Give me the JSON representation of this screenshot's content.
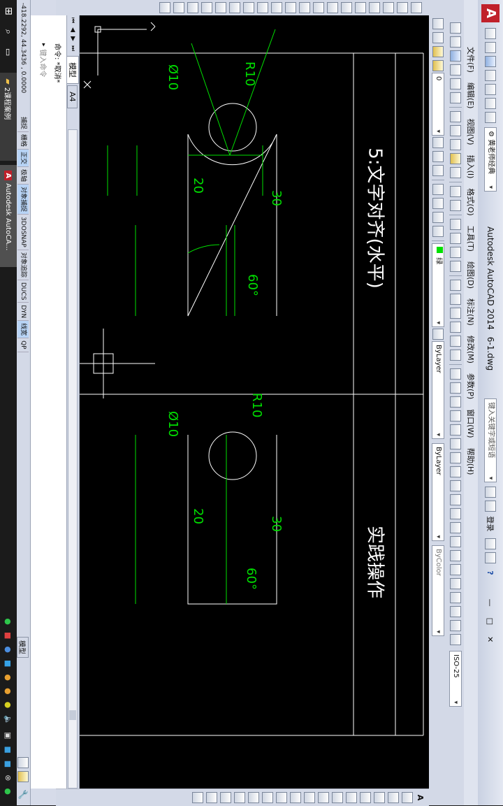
{
  "title_bar": {
    "app_title": "Autodesk AutoCAD 2014",
    "file_name": "6-1.dwg",
    "workspace": "黄老师经典",
    "search_placeholder": "键入关键字或短语",
    "login_label": "登录"
  },
  "menu": [
    "文件(F)",
    "编辑(E)",
    "视图(V)",
    "插入(I)",
    "格式(O)",
    "工具(T)",
    "绘图(D)",
    "标注(N)",
    "修改(M)",
    "参数(P)",
    "窗口(W)",
    "帮助(H)"
  ],
  "properties": {
    "layer": "0",
    "color_label": "绿",
    "linetype": "ByLayer",
    "lineweight": "ByLayer",
    "plotstyle": "ByColor",
    "dimstyle": "ISO-25"
  },
  "tabs": {
    "model": "模型",
    "layout": "A4"
  },
  "drawing": {
    "heading_left": "5:文字对齐(水平)",
    "heading_right": "实践操作",
    "left_part": {
      "r": "R10",
      "d": "Ø10",
      "width": "20",
      "height": "30",
      "angle": "60°"
    },
    "right_part": {
      "r": "R10",
      "d": "Ø10",
      "width": "20",
      "height": "30",
      "angle": "60°"
    }
  },
  "command_area": {
    "line1": "命令: *取消*",
    "placeholder": "键入命令"
  },
  "status_bar": {
    "coords": "-418.2292, 44.3436 , 0.0000",
    "toggles": [
      {
        "label": "捕捉",
        "on": false
      },
      {
        "label": "栅格",
        "on": false
      },
      {
        "label": "正交",
        "on": true
      },
      {
        "label": "极轴",
        "on": false
      },
      {
        "label": "对象捕捉",
        "on": true
      },
      {
        "label": "3DOSNAP",
        "on": false
      },
      {
        "label": "对象追踪",
        "on": false
      },
      {
        "label": "DUCS",
        "on": false
      },
      {
        "label": "DYN",
        "on": false
      },
      {
        "label": "线宽",
        "on": true
      },
      {
        "label": "QP",
        "on": false
      }
    ],
    "model_label": "模型"
  },
  "taskbar": {
    "item1": "2课程案例",
    "item2": "Autodesk AutoCA..."
  },
  "colors": {
    "canvas": "#000000",
    "dim_green": "#00e000",
    "line_white": "#ffffff",
    "ui_bg": "#d6dbe9",
    "taskbar": "#1b1b1b"
  }
}
